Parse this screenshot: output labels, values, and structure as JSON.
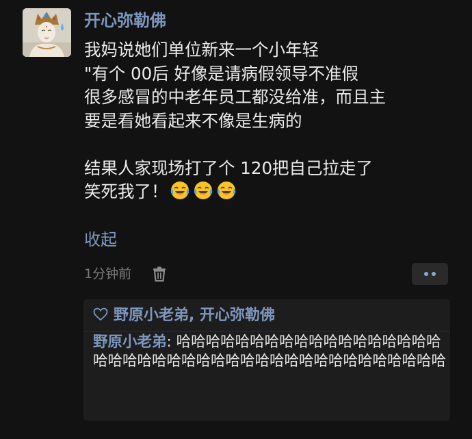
{
  "post": {
    "author": "开心弥勒佛",
    "avatar_icon": "buddha-statue-avatar",
    "lines": [
      "我妈说她们单位新来一个小年轻",
      "\"有个 00后 好像是请病假领导不准假",
      "很多感冒的中老年员工都没给准，而且主",
      "要是看她看起来不像是生病的",
      "",
      "结果人家现场打了个 120把自己拉走了"
    ],
    "last_line_text": "笑死我了！",
    "emoji_icon": "laughing-crying-emoji",
    "collapse_label": "收起",
    "time": "1分钟前",
    "delete_icon": "trash-icon",
    "more_icon": "more-dots-icon"
  },
  "likes": {
    "heart_icon": "heart-outline-icon",
    "names": "野原小老弟, 开心弥勒佛"
  },
  "reply": {
    "author": "野原小老弟",
    "separator": ": ",
    "text": "哈哈哈哈哈哈哈哈哈哈哈哈哈哈哈哈哈哈哈哈哈哈哈哈哈哈哈哈哈哈哈哈哈哈哈哈哈哈哈哈哈哈"
  },
  "colors": {
    "background": "#121212",
    "name_link": "#7e97bf",
    "body_text": "#ececec",
    "muted": "#7a7a7a",
    "panel": "#1d1d1d"
  }
}
